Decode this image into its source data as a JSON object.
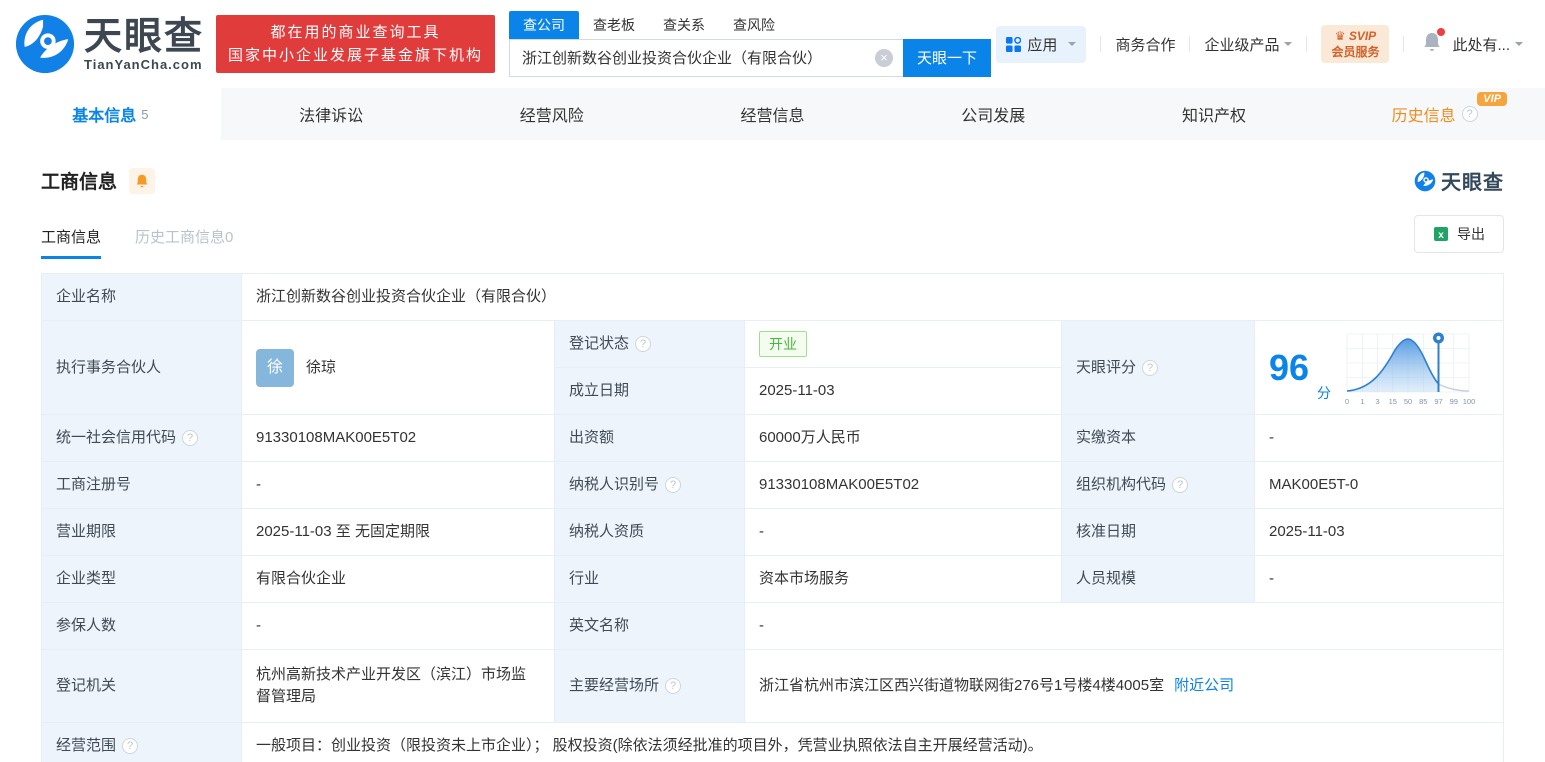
{
  "brand": {
    "logo_cn": "天眼查",
    "logo_en": "TianYanCha.com",
    "slogan_line1": "都在用的商业查询工具",
    "slogan_line2": "国家中小企业发展子基金旗下机构"
  },
  "search": {
    "tabs": [
      {
        "label": "查公司"
      },
      {
        "label": "查老板"
      },
      {
        "label": "查关系"
      },
      {
        "label": "查风险"
      }
    ],
    "value": "浙江创新数谷创业投资合伙企业（有限合伙）",
    "button": "天眼一下",
    "clear_icon": "×"
  },
  "header_nav": {
    "apps": "应用",
    "cooperation": "商务合作",
    "enterprise": "企业级产品",
    "svip_line1": "SVIP",
    "svip_line2": "会员服务",
    "user": "此处有..."
  },
  "tabs": {
    "items": [
      {
        "label": "基本信息",
        "badge": "5"
      },
      {
        "label": "法律诉讼"
      },
      {
        "label": "经营风险"
      },
      {
        "label": "经营信息"
      },
      {
        "label": "公司发展"
      },
      {
        "label": "知识产权"
      },
      {
        "label": "历史信息",
        "vip": "VIP",
        "help": "?"
      }
    ]
  },
  "section": {
    "title": "工商信息",
    "watermark": "天眼查",
    "subtab_active": "工商信息",
    "subtab_history": "历史工商信息",
    "subtab_history_count": "0",
    "export": "导出"
  },
  "fields": {
    "company_name": {
      "label": "企业名称",
      "value": "浙江创新数谷创业投资合伙企业（有限合伙）"
    },
    "partner": {
      "label": "执行事务合伙人",
      "avatar": "徐",
      "name": "徐琼"
    },
    "reg_status": {
      "label": "登记状态",
      "help": "?",
      "value": "开业"
    },
    "est_date": {
      "label": "成立日期",
      "value": "2025-11-03"
    },
    "score": {
      "label": "天眼评分",
      "help": "?",
      "value": "96",
      "unit": "分"
    },
    "credit_code": {
      "label": "统一社会信用代码",
      "help": "?",
      "value": "91330108MAK00E5T02"
    },
    "contribution": {
      "label": "出资额",
      "value": "60000万人民币"
    },
    "paid_capital": {
      "label": "实缴资本",
      "value": "-"
    },
    "reg_number": {
      "label": "工商注册号",
      "value": "-"
    },
    "taxpayer_id": {
      "label": "纳税人识别号",
      "help": "?",
      "value": "91330108MAK00E5T02"
    },
    "org_code": {
      "label": "组织机构代码",
      "help": "?",
      "value": "MAK00E5T-0"
    },
    "business_term": {
      "label": "营业期限",
      "value": "2025-11-03 至 无固定期限"
    },
    "taxpayer_qualification": {
      "label": "纳税人资质",
      "value": "-"
    },
    "approval_date": {
      "label": "核准日期",
      "value": "2025-11-03"
    },
    "company_type": {
      "label": "企业类型",
      "value": "有限合伙企业"
    },
    "industry": {
      "label": "行业",
      "value": "资本市场服务"
    },
    "staff_size": {
      "label": "人员规模",
      "value": "-"
    },
    "insured_count": {
      "label": "参保人数",
      "value": "-"
    },
    "english_name": {
      "label": "英文名称",
      "value": "-"
    },
    "registration_authority": {
      "label": "登记机关",
      "value": "杭州高新技术产业开发区（滨江）市场监督管理局"
    },
    "business_address": {
      "label": "主要经营场所",
      "help": "?",
      "value": "浙江省杭州市滨江区西兴街道物联网街276号1号楼4楼4005室",
      "link": "附近公司"
    },
    "business_scope": {
      "label": "经营范围",
      "help": "?",
      "value": "一般项目：创业投资（限投资未上市企业）； 股权投资(除依法须经批准的项目外，凭营业执照依法自主开展经营活动)。"
    }
  },
  "score_chart": {
    "type": "area",
    "description": "score distribution bell curve with marker at company score position",
    "ticks": [
      "0",
      "1",
      "3",
      "15",
      "50",
      "85",
      "97",
      "99",
      "100"
    ],
    "marker_tick": "97",
    "accent_color": "#2f7fd1"
  },
  "colors": {
    "brand_blue": "#0a84e8",
    "slogan_red": "#e03c3c",
    "vip_orange": "#f6a43b",
    "status_green": "#46b93c"
  }
}
